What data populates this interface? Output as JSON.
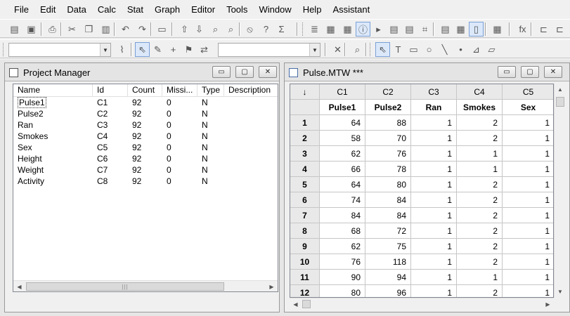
{
  "menu": [
    {
      "label": "File",
      "key": "F",
      "rest": "ile"
    },
    {
      "label": "Edit",
      "key": "E",
      "rest": "dit"
    },
    {
      "label": "Data",
      "key": "D",
      "rest": "ata"
    },
    {
      "label": "Calc",
      "key": "C",
      "rest": "alc"
    },
    {
      "label": "Stat",
      "key": "S",
      "rest": "tat"
    },
    {
      "label": "Graph",
      "key": "G",
      "rest": "raph"
    },
    {
      "label": "Editor",
      "key": "",
      "pre": "Edi",
      "k2": "t",
      "rest": "or"
    },
    {
      "label": "Tools",
      "key": "T",
      "rest": "ools"
    },
    {
      "label": "Window",
      "key": "W",
      "rest": "indow"
    },
    {
      "label": "Help",
      "key": "H",
      "rest": "elp"
    },
    {
      "label": "Assistant",
      "key": "",
      "pre": "",
      "k2": "",
      "rest": "Assistant"
    }
  ],
  "project_manager": {
    "title": "Project Manager",
    "columns": [
      "Name",
      "Id",
      "Count",
      "Missi...",
      "Type",
      "Description"
    ],
    "rows": [
      [
        "Pulse1",
        "C1",
        "92",
        "0",
        "N",
        ""
      ],
      [
        "Pulse2",
        "C2",
        "92",
        "0",
        "N",
        ""
      ],
      [
        "Ran",
        "C3",
        "92",
        "0",
        "N",
        ""
      ],
      [
        "Smokes",
        "C4",
        "92",
        "0",
        "N",
        ""
      ],
      [
        "Sex",
        "C5",
        "92",
        "0",
        "N",
        ""
      ],
      [
        "Height",
        "C6",
        "92",
        "0",
        "N",
        ""
      ],
      [
        "Weight",
        "C7",
        "92",
        "0",
        "N",
        ""
      ],
      [
        "Activity",
        "C8",
        "92",
        "0",
        "N",
        ""
      ]
    ],
    "selected_row": 0
  },
  "worksheet": {
    "title": "Pulse.MTW ***",
    "corner_symbol": "↓",
    "column_ids": [
      "C1",
      "C2",
      "C3",
      "C4",
      "C5"
    ],
    "column_names": [
      "Pulse1",
      "Pulse2",
      "Ran",
      "Smokes",
      "Sex"
    ],
    "rows": [
      {
        "n": "1",
        "v": [
          "64",
          "88",
          "1",
          "2",
          "1"
        ]
      },
      {
        "n": "2",
        "v": [
          "58",
          "70",
          "1",
          "2",
          "1"
        ]
      },
      {
        "n": "3",
        "v": [
          "62",
          "76",
          "1",
          "1",
          "1"
        ]
      },
      {
        "n": "4",
        "v": [
          "66",
          "78",
          "1",
          "1",
          "1"
        ]
      },
      {
        "n": "5",
        "v": [
          "64",
          "80",
          "1",
          "2",
          "1"
        ]
      },
      {
        "n": "6",
        "v": [
          "74",
          "84",
          "1",
          "2",
          "1"
        ]
      },
      {
        "n": "7",
        "v": [
          "84",
          "84",
          "1",
          "2",
          "1"
        ]
      },
      {
        "n": "8",
        "v": [
          "68",
          "72",
          "1",
          "2",
          "1"
        ]
      },
      {
        "n": "9",
        "v": [
          "62",
          "75",
          "1",
          "2",
          "1"
        ]
      },
      {
        "n": "10",
        "v": [
          "76",
          "118",
          "1",
          "2",
          "1"
        ]
      },
      {
        "n": "11",
        "v": [
          "90",
          "94",
          "1",
          "1",
          "1"
        ]
      },
      {
        "n": "12",
        "v": [
          "80",
          "96",
          "1",
          "2",
          "1"
        ]
      }
    ]
  },
  "window_buttons": {
    "minimize": "▭",
    "maximize": "▢",
    "close": "✕"
  },
  "toolbar_icons": {
    "tb1": [
      "open-icon",
      "save-icon",
      "print-icon",
      "cut-icon",
      "copy-icon",
      "paste-icon",
      "undo-icon",
      "redo-icon",
      "session-icon",
      "prev-icon",
      "next-icon",
      "find-icon",
      "find-next-icon",
      "cancel-icon",
      "help-icon",
      "stat-guide-icon",
      "show-session-icon",
      "show-data-icon",
      "show-graphs-icon",
      "show-info-icon",
      "show-history-icon",
      "report-icon",
      "related-docs-icon",
      "design-icon",
      "columns-icon",
      "worksheet-icon",
      "project-manager-icon",
      "close-graphs-icon",
      "formula-icon"
    ],
    "tb2": [
      "brush-icon",
      "select-icon",
      "pen-icon",
      "crosshair-icon",
      "flag-icon",
      "swap-icon",
      "delete-icon",
      "zoom-icon",
      "pointer-icon",
      "text-icon",
      "rectangle-icon",
      "ellipse-icon",
      "line-icon",
      "dot-icon",
      "polyline-icon",
      "polygon-icon"
    ]
  }
}
